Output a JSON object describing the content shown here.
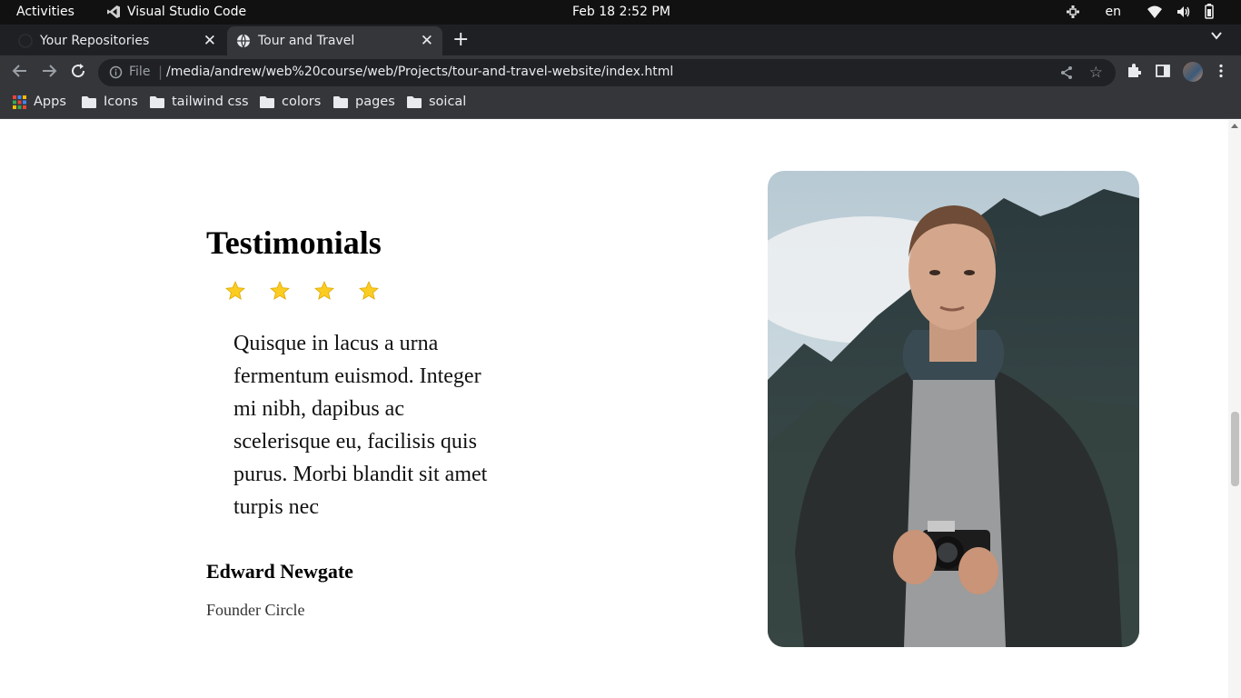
{
  "system_bar": {
    "activities": "Activities",
    "app_name": "Visual Studio Code",
    "clock": "Feb 18  2:52 PM",
    "lang": "en"
  },
  "tabs": [
    {
      "label": "Your Repositories",
      "icon": "github-icon"
    },
    {
      "label": "Tour and Travel",
      "icon": "globe-icon"
    }
  ],
  "address_bar": {
    "scheme_label": "File",
    "url": "/media/andrew/web%20course/web/Projects/tour-and-travel-website/index.html"
  },
  "bookmarks": [
    {
      "label": "Apps",
      "icon": "apps-grid-icon"
    },
    {
      "label": "Icons",
      "icon": "folder-icon"
    },
    {
      "label": "tailwind css",
      "icon": "folder-icon"
    },
    {
      "label": "colors",
      "icon": "folder-icon"
    },
    {
      "label": "pages",
      "icon": "folder-icon"
    },
    {
      "label": "soical",
      "icon": "folder-icon"
    }
  ],
  "testimonial": {
    "title": "Testimonials",
    "rating": 4,
    "quote": "Quisque in lacus a urna fermentum euismod. Integer mi nibh, dapibus ac scelerisque eu, facilisis quis purus. Morbi blandit sit amet turpis nec",
    "author": "Edward Newgate",
    "role": "Founder Circle"
  },
  "colors": {
    "star": "#fbcc21",
    "title": "#000000",
    "chrome_dark": "#35363a"
  }
}
